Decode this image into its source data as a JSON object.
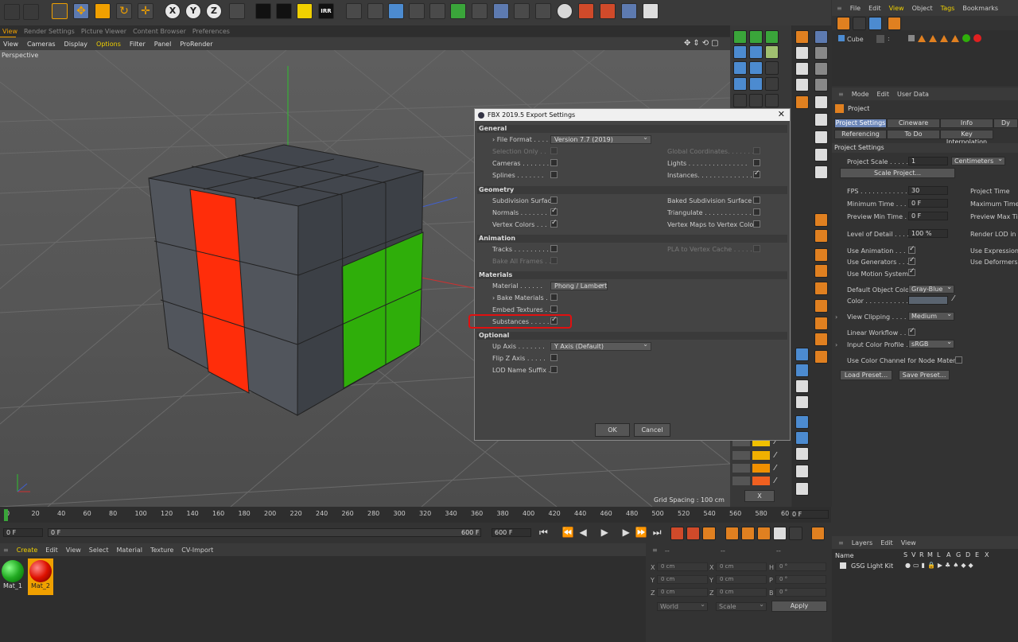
{
  "top_menu": [
    "File",
    "Edit",
    "View",
    "Object",
    "Tags",
    "Bookmarks"
  ],
  "top_menu_active": "View",
  "axis_buttons": [
    "X",
    "Y",
    "Z"
  ],
  "irr_label": "IRR",
  "viewport_tabs": [
    "View",
    "Render Settings",
    "Picture Viewer",
    "Content Browser",
    "Preferences"
  ],
  "viewport_menu": [
    "View",
    "Cameras",
    "Display",
    "Options",
    "Filter",
    "Panel",
    "ProRender"
  ],
  "viewport_menu_active": "Options",
  "viewport_label": "Perspective",
  "grid_spacing": "Grid Spacing : 100 cm",
  "colors": {
    "cube_dark": "#454a53",
    "cube_red": "#ff2d0a",
    "cube_green": "#2fae0a",
    "accent": "#f0a000",
    "active_tab": "#6d87b8"
  },
  "dialog": {
    "title": "FBX 2019.5 Export Settings",
    "sections": {
      "general": "General",
      "geometry": "Geometry",
      "animation": "Animation",
      "materials": "Materials",
      "optional": "Optional"
    },
    "general": {
      "file_format_label": "File Format . . . .",
      "file_format_value": "Version 7.7 (2019)",
      "selection_only": "Selection Only . .",
      "cameras": "Cameras . . . . . . .",
      "splines": "Splines . . . . . . .",
      "global_coords": "Global Coordinates. . . . . . . .",
      "lights": "Lights . . . . . . . . . . . . . . .",
      "instances": "Instances. . . . . . . . . . . . . ."
    },
    "geometry": {
      "subdivision": "Subdivision Surface",
      "normals": "Normals . . . . . . .",
      "vertex_colors": "Vertex Colors . . .",
      "baked_subdivision": "Baked Subdivision Surface . .",
      "triangulate": "Triangulate . . . . . . . . . . . .",
      "vertex_maps": "Vertex Maps to Vertex Colors"
    },
    "animation": {
      "tracks": "Tracks . . . . . . . . .",
      "bake_all_frames": "Bake All Frames . .",
      "pla": "PLA to Vertex Cache . . . . . ."
    },
    "materials": {
      "material_label": "Material . . . . . .",
      "material_value": "Phong / Lambert",
      "bake_materials": "Bake Materials . .",
      "embed_textures": "Embed Textures . .",
      "substances": "Substances . . . . ."
    },
    "optional": {
      "up_axis_label": "Up Axis . . . . . . .",
      "up_axis_value": "Y Axis (Default)",
      "flip_z": "Flip Z Axis . . . . .",
      "lod": "LOD Name Suffix . ."
    },
    "ok": "OK",
    "cancel": "Cancel"
  },
  "object_manager": {
    "menu": [
      "File",
      "Edit",
      "View",
      "Object",
      "Tags",
      "Bookmarks"
    ],
    "object": "Cube"
  },
  "attributes": {
    "menu": [
      "Mode",
      "Edit",
      "User Data"
    ],
    "header": "Project",
    "tabs_row1": [
      "Project Settings",
      "Cineware",
      "Info",
      "Dy"
    ],
    "tabs_row2": [
      "Referencing",
      "To Do",
      "Key Interpolation"
    ],
    "section": "Project Settings",
    "project_scale_label": "Project Scale . . . . .",
    "project_scale_value": "1",
    "project_scale_unit": "Centimeters",
    "scale_project": "Scale Project...",
    "fps_label": "FPS . . . . . . . . . . . .",
    "fps_value": "30",
    "project_time": "Project Time",
    "min_time_label": "Minimum Time . . . .",
    "min_time_value": "0 F",
    "max_time": "Maximum Time",
    "preview_min_label": "Preview Min Time . .",
    "preview_min_value": "0 F",
    "preview_max": "Preview Max Tim",
    "lod_label": "Level of Detail . . . .",
    "lod_value": "100 %",
    "render_lod": "Render LOD in E",
    "use_animation": "Use Animation . . . .",
    "use_expression": "Use Expression",
    "use_generators": "Use Generators . . .",
    "use_deformers": "Use Deformers",
    "use_motion": "Use Motion System",
    "default_color_label": "Default Object Color",
    "default_color_value": "Gray-Blue",
    "color_label": "Color . . . . . . . . . . .",
    "view_clipping_label": "View Clipping . . . . .",
    "view_clipping_value": "Medium",
    "linear_workflow": "Linear Workflow . . .",
    "input_profile_label": "Input Color Profile . .",
    "input_profile_value": "sRGB",
    "use_color_channel": "Use Color Channel for Node Material",
    "load_preset": "Load Preset...",
    "save_preset": "Save Preset..."
  },
  "timeline": {
    "ticks": [
      "0",
      "20",
      "40",
      "60",
      "80",
      "100",
      "120",
      "140",
      "160",
      "180",
      "200",
      "220",
      "240",
      "260",
      "280",
      "300",
      "320",
      "340",
      "360",
      "380",
      "400",
      "420",
      "440",
      "460",
      "480",
      "500",
      "520",
      "540",
      "560",
      "580",
      "60"
    ],
    "end_field": "0 F",
    "start_field": "0 F",
    "start_field2": "0 F",
    "end_frame": "600 F",
    "end_frame2": "600 F"
  },
  "material_manager": {
    "menu": [
      "Create",
      "Edit",
      "View",
      "Select",
      "Material",
      "Texture",
      "CV-Import"
    ],
    "materials": [
      "Mat_1",
      "Mat_2"
    ]
  },
  "coordinates": {
    "header": [
      "--",
      "--",
      "--"
    ],
    "rows": [
      {
        "a": "X",
        "av": "0 cm",
        "b": "X",
        "bv": "0 cm",
        "c": "H",
        "cv": "0 °"
      },
      {
        "a": "Y",
        "av": "0 cm",
        "b": "Y",
        "bv": "0 cm",
        "c": "P",
        "cv": "0 °"
      },
      {
        "a": "Z",
        "av": "0 cm",
        "b": "Z",
        "bv": "0 cm",
        "c": "B",
        "cv": "0 °"
      }
    ],
    "world": "World",
    "scale": "Scale",
    "apply": "Apply"
  },
  "layers": {
    "menu": [
      "Layers",
      "Edit",
      "View"
    ],
    "name_col": "Name",
    "cols": [
      "S",
      "V",
      "R",
      "M",
      "L",
      "A",
      "G",
      "D",
      "E",
      "X"
    ],
    "row": "GSG Light Kit"
  },
  "swatch_close": "X"
}
